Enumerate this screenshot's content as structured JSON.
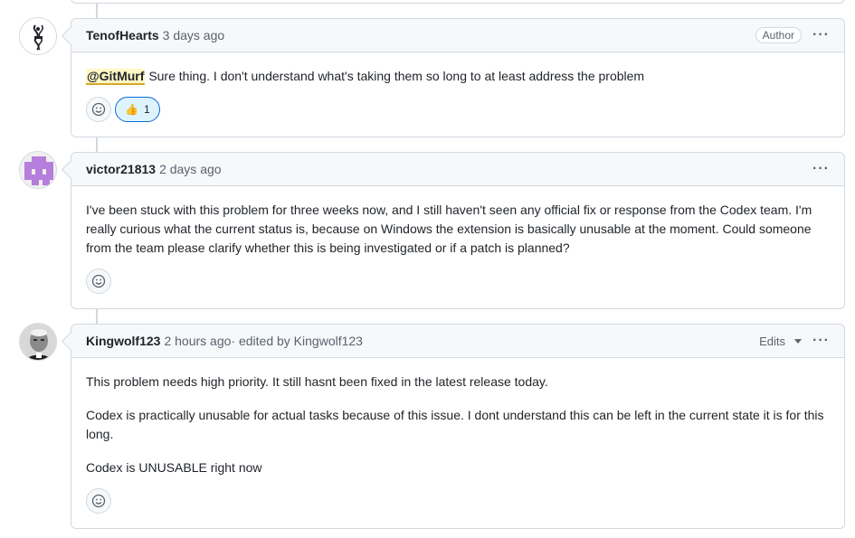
{
  "comments": [
    {
      "author": "TenofHearts",
      "time": "3 days ago",
      "badge": "Author",
      "mention": "@GitMurf",
      "paragraphs": [
        "Sure thing. I don't understand what's taking them so long to at least address the problem"
      ],
      "reaction": {
        "emoji": "👍",
        "count": "1"
      }
    },
    {
      "author": "victor21813",
      "time": "2 days ago",
      "paragraphs": [
        "I've been stuck with this problem for three weeks now, and I still haven't seen any official fix or response from the Codex team. I'm really curious what the current status is, because on Windows the extension is basically unusable at the moment. Could someone from the team please clarify whether this is being investigated or if a patch is planned?"
      ]
    },
    {
      "author": "Kingwolf123",
      "time": "2 hours ago",
      "edited": " · edited by Kingwolf123",
      "edits_label": "Edits",
      "paragraphs": [
        "This problem needs high priority. It still hasnt been fixed in the latest release today.",
        "Codex is practically unusable for actual tasks because of this issue. I dont understand this can be left in the current state it is for this long.",
        "Codex is UNUSABLE right now"
      ]
    }
  ],
  "icons": {
    "more": "kebab-horizontal-icon",
    "add_reaction": "smiley-icon",
    "dropdown": "triangle-down-icon"
  },
  "colors": {
    "border": "#d1d9e0",
    "header_bg": "#f6f8fa",
    "mention_bg": "#fff8c5",
    "reaction_border": "#0969da",
    "reaction_bg": "#ddf4ff",
    "muted": "#59636e"
  }
}
